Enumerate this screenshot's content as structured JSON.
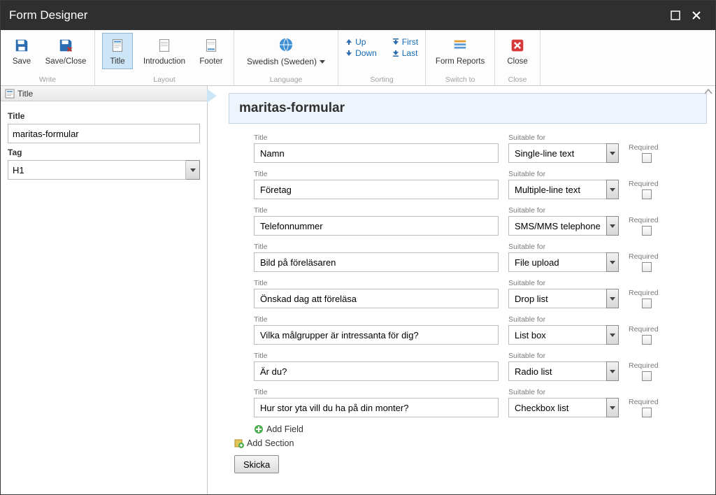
{
  "window": {
    "title": "Form Designer"
  },
  "ribbon": {
    "write": {
      "save": "Save",
      "save_close": "Save/Close",
      "group": "Write"
    },
    "layout": {
      "title": "Title",
      "introduction": "Introduction",
      "footer": "Footer",
      "group": "Layout"
    },
    "language": {
      "label": "Swedish (Sweden)",
      "group": "Language"
    },
    "sorting": {
      "up": "Up",
      "down": "Down",
      "first": "First",
      "last": "Last",
      "group": "Sorting"
    },
    "switch": {
      "form_reports": "Form Reports",
      "group": "Switch to"
    },
    "close": {
      "close": "Close",
      "group": "Close"
    }
  },
  "side": {
    "tab": "Title",
    "title_label": "Title",
    "title_value": "maritas-formular",
    "tag_label": "Tag",
    "tag_value": "H1"
  },
  "form": {
    "title": "maritas-formular",
    "labels": {
      "title": "Title",
      "suitable": "Suitable for",
      "required": "Required"
    },
    "fields": [
      {
        "title": "Namn",
        "type": "Single-line text"
      },
      {
        "title": "Företag",
        "type": "Multiple-line text"
      },
      {
        "title": "Telefonnummer",
        "type": "SMS/MMS telephone"
      },
      {
        "title": "Bild på föreläsaren",
        "type": "File upload"
      },
      {
        "title": "Önskad dag att föreläsa",
        "type": "Drop list"
      },
      {
        "title": "Vilka målgrupper är intressanta för dig?",
        "type": "List box"
      },
      {
        "title": "Är du?",
        "type": "Radio list"
      },
      {
        "title": "Hur stor yta vill du ha på din monter?",
        "type": "Checkbox list"
      }
    ],
    "add_field": "Add Field",
    "add_section": "Add Section",
    "submit": "Skicka"
  }
}
